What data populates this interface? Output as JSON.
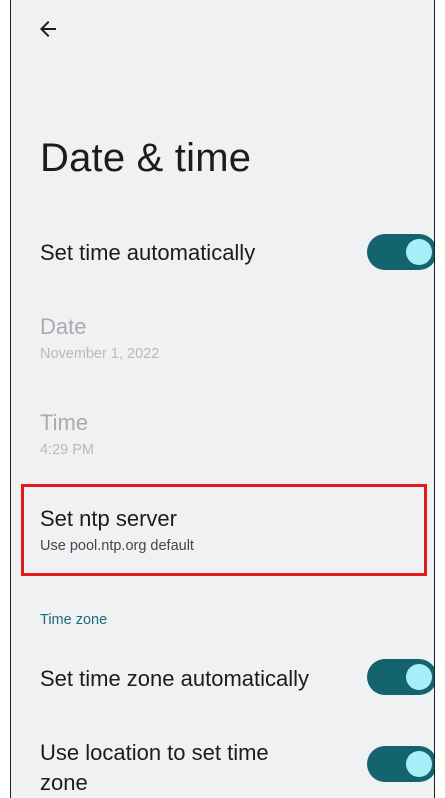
{
  "header": {
    "back_icon": "arrow-back-icon",
    "title": "Date & time"
  },
  "settings": {
    "set_time_auto": {
      "label": "Set time automatically",
      "enabled": true
    },
    "date": {
      "label": "Date",
      "value": "November 1, 2022"
    },
    "time": {
      "label": "Time",
      "value": "4:29 PM"
    },
    "ntp": {
      "label": "Set ntp server",
      "summary": "Use pool.ntp.org default"
    }
  },
  "time_zone_section": {
    "header": "Time zone",
    "set_tz_auto": {
      "label": "Set time zone automatically",
      "enabled": true
    },
    "use_location": {
      "label_line1": "Use location to set time",
      "label_line2": "zone",
      "enabled": true
    }
  },
  "colors": {
    "background": "#f0f1f3",
    "toggle_track": "#13646f",
    "toggle_knob": "#a8eef8",
    "accent": "#196c79",
    "highlight": "#e41b1b"
  }
}
